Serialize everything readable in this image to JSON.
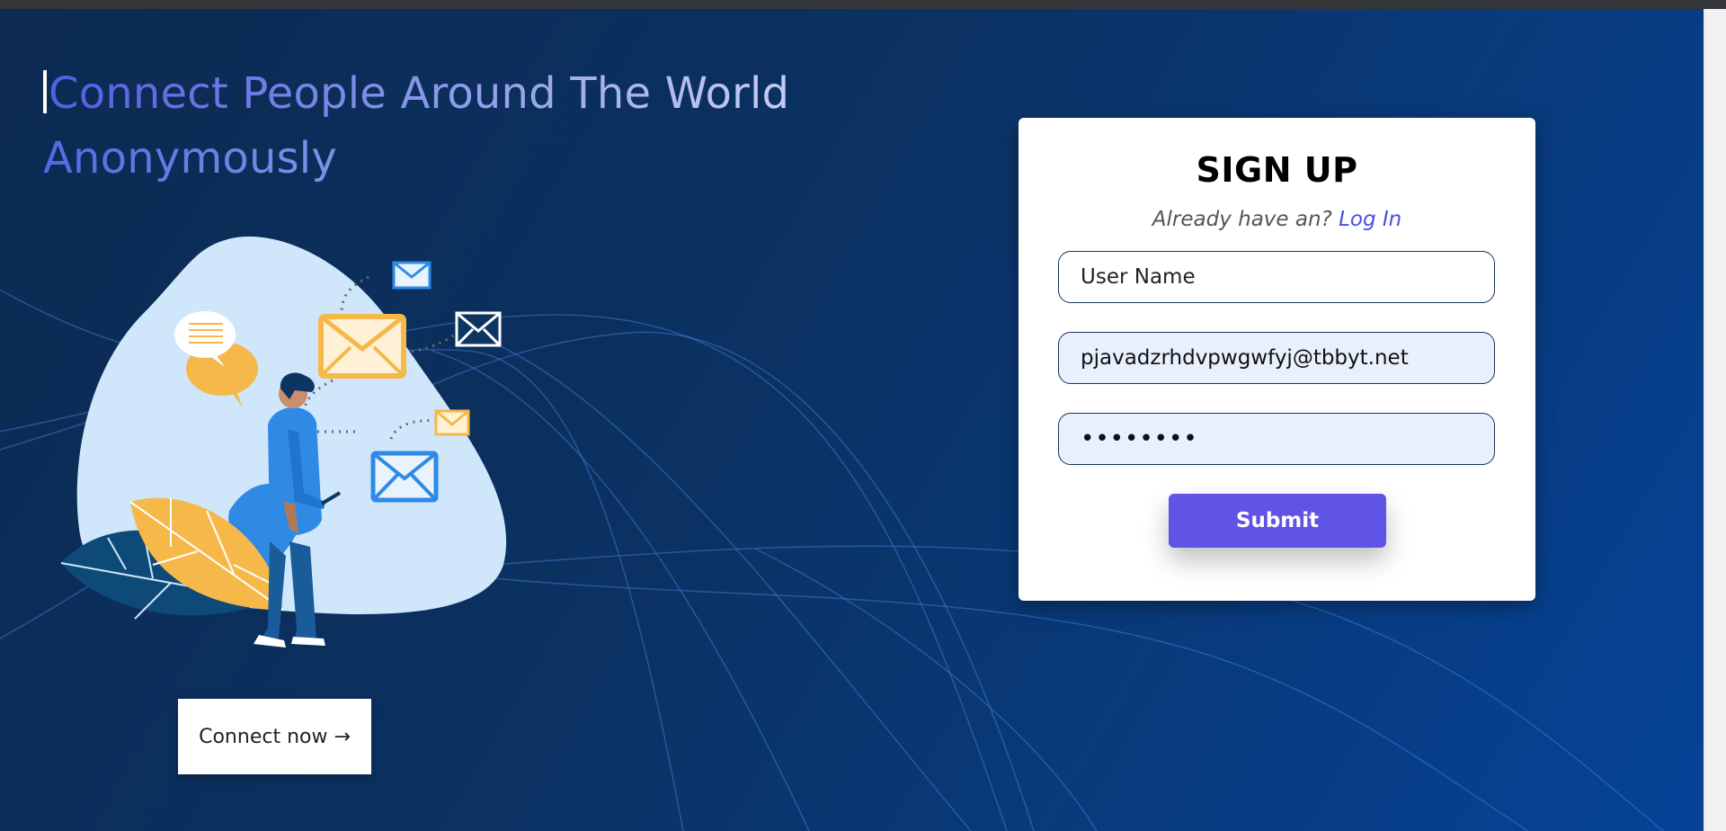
{
  "hero": {
    "headline_line1": "Connect People Around The World",
    "headline_line2": "Anonymously",
    "connect_button": "Connect now →"
  },
  "signup": {
    "title": "SIGN UP",
    "subtitle_prefix": "Already have an?",
    "login_link": "Log In",
    "username_placeholder": "User Name",
    "email_value": "pjavadzrhdvpwgwfyj@tbbyt.net",
    "password_value": "••••••••",
    "submit_label": "Submit"
  },
  "colors": {
    "background_start": "#0c2a52",
    "background_end": "#064397",
    "accent": "#6054e6",
    "link": "#4a4ee6",
    "autofill": "#e8f0fe"
  }
}
